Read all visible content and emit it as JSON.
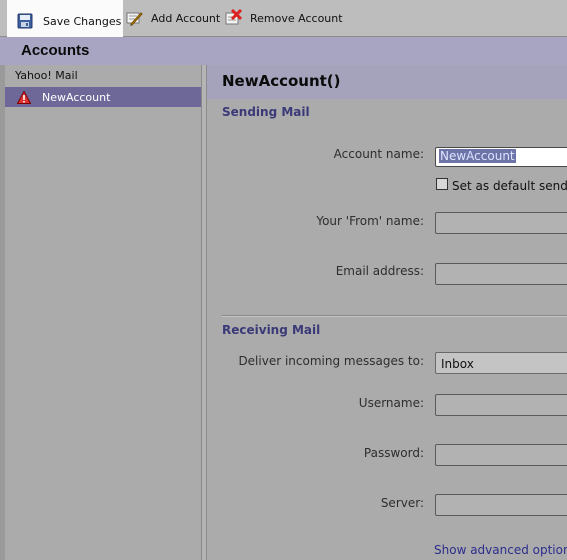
{
  "toolbar": {
    "save_label": "Save Changes",
    "add_label": "Add Account",
    "remove_label": "Remove Account"
  },
  "accounts_title": "Accounts",
  "account_list": {
    "group": "Yahoo! Mail",
    "items": [
      {
        "label": "NewAccount",
        "icon": "warning-icon",
        "selected": true
      }
    ]
  },
  "detail": {
    "heading": "NewAccount()",
    "sending": {
      "title": "Sending Mail",
      "account_name_label": "Account name:",
      "account_name_value": "NewAccount",
      "default_checkbox_label": "Set as default sendi",
      "from_name_label": "Your 'From' name:",
      "from_name_value": "",
      "email_label": "Email address:",
      "email_value": ""
    },
    "receiving": {
      "title": "Receiving Mail",
      "deliver_label": "Deliver incoming messages to:",
      "deliver_value": "Inbox",
      "username_label": "Username:",
      "username_value": "",
      "password_label": "Password:",
      "password_value": "",
      "server_label": "Server:",
      "server_value": ""
    },
    "advanced_link": "Show advanced options"
  },
  "colors": {
    "toolbar_bg": "#bdbdbd",
    "header_band": "#a7a5c2",
    "selection": "#6d6898",
    "section_title": "#3a3a78",
    "link": "#2b2d8c"
  }
}
